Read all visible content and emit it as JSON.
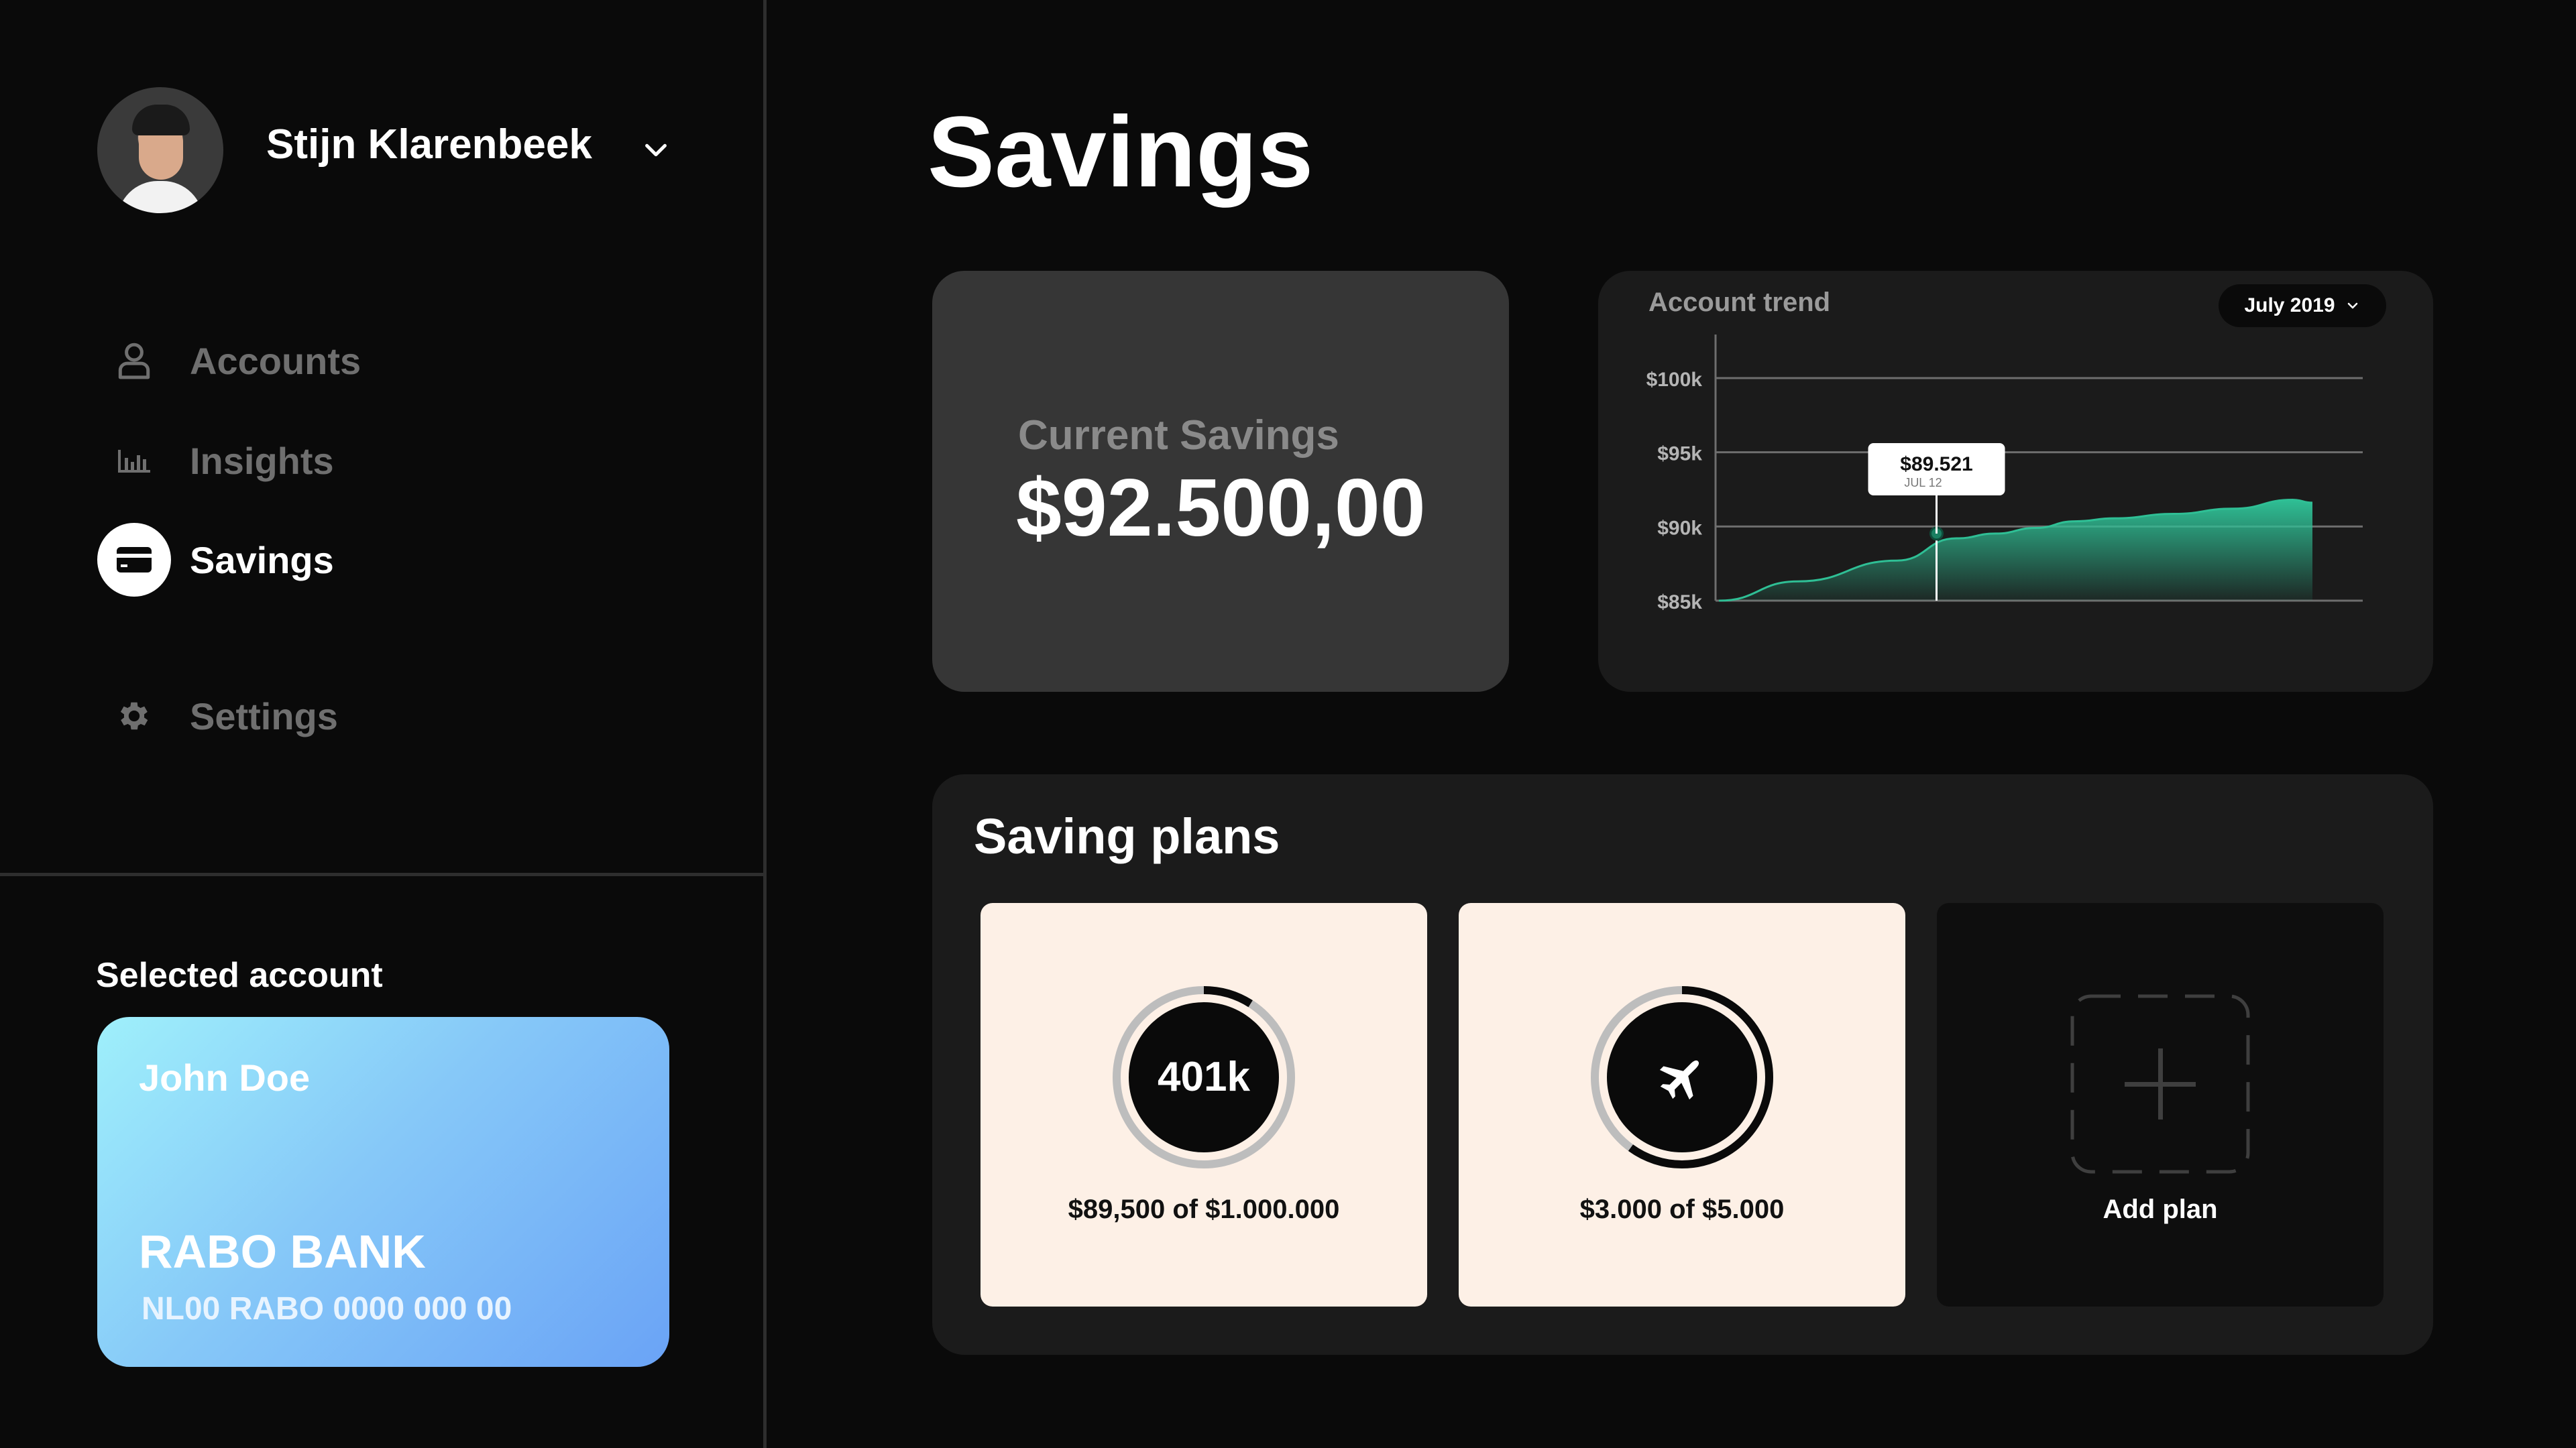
{
  "user": {
    "name": "Stijn Klarenbeek"
  },
  "nav": {
    "items": [
      {
        "label": "Accounts",
        "icon": "user-icon",
        "active": false
      },
      {
        "label": "Insights",
        "icon": "bar-chart-icon",
        "active": false
      },
      {
        "label": "Savings",
        "icon": "credit-card-icon",
        "active": true
      },
      {
        "label": "Settings",
        "icon": "gear-icon",
        "active": false
      }
    ]
  },
  "selected_account": {
    "title": "Selected account",
    "holder": "John Doe",
    "bank": "RABO BANK",
    "iban": "NL00 RABO 0000 000 00",
    "gradient": [
      "#9ff0fb",
      "#6aa3f6"
    ]
  },
  "page": {
    "title": "Savings"
  },
  "current_savings": {
    "label": "Current Savings",
    "value": "$92.500,00"
  },
  "trend": {
    "title": "Account trend",
    "month": "July 2019",
    "tooltip": {
      "value": "$89.521",
      "date": "JUL 12"
    },
    "accent": "#2fbf95"
  },
  "chart_data": {
    "type": "area",
    "title": "Account trend",
    "y_tick_labels": [
      "$100k",
      "$95k",
      "$90k",
      "$85k"
    ],
    "ylim": [
      85000,
      100000
    ],
    "x": [
      1,
      5,
      10,
      13,
      15,
      17,
      19,
      21,
      24,
      27,
      30,
      31
    ],
    "values": [
      85000,
      86300,
      87700,
      89200,
      89521,
      89900,
      90350,
      90550,
      90850,
      91200,
      91800,
      91600
    ],
    "highlight": {
      "x": 12,
      "value": 89521,
      "label": "JUL 12"
    },
    "grid": true
  },
  "plans": {
    "title": "Saving plans",
    "items": [
      {
        "center_text": "401k",
        "icon": "",
        "amount": "$89,500 of $1.000.000",
        "progress": 0.09
      },
      {
        "center_text": "",
        "icon": "airplane-icon",
        "amount": "$3.000 of $5.000",
        "progress": 0.6
      }
    ],
    "add_label": "Add plan"
  }
}
